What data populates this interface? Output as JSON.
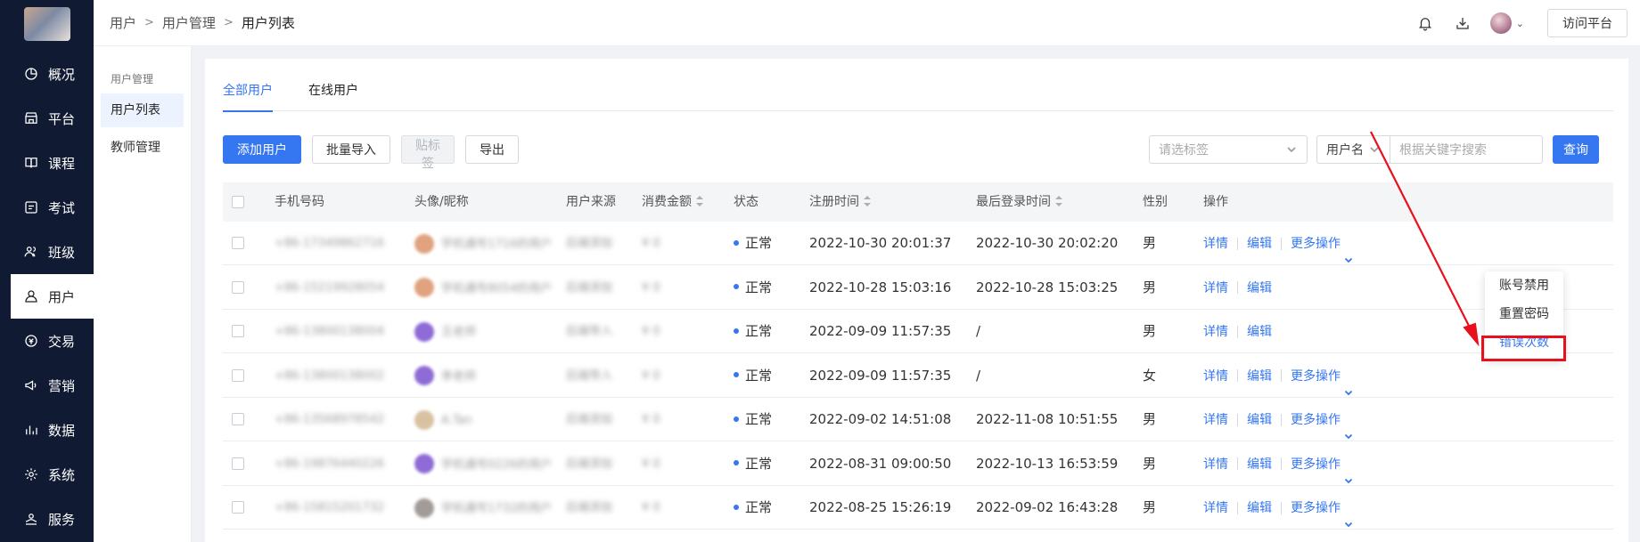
{
  "nav": {
    "items": [
      {
        "label": "概况",
        "icon": "overview-icon"
      },
      {
        "label": "平台",
        "icon": "store-icon"
      },
      {
        "label": "课程",
        "icon": "book-icon"
      },
      {
        "label": "考试",
        "icon": "exam-icon"
      },
      {
        "label": "班级",
        "icon": "class-icon"
      },
      {
        "label": "用户",
        "icon": "user-icon",
        "active": true
      },
      {
        "label": "交易",
        "icon": "trade-icon"
      },
      {
        "label": "营销",
        "icon": "marketing-icon"
      },
      {
        "label": "数据",
        "icon": "data-icon"
      },
      {
        "label": "系统",
        "icon": "system-icon"
      },
      {
        "label": "服务",
        "icon": "service-icon"
      }
    ]
  },
  "header": {
    "breadcrumb": [
      "用户",
      "用户管理",
      "用户列表"
    ],
    "visit_button": "访问平台"
  },
  "subnav": {
    "group": "用户管理",
    "items": [
      "用户列表",
      "教师管理"
    ]
  },
  "tabs": [
    "全部用户",
    "在线用户"
  ],
  "toolbar": {
    "add_user": "添加用户",
    "batch_import": "批量导入",
    "tag": "贴标签",
    "export": "导出",
    "tag_select_placeholder": "请选标签",
    "field_select": "用户名",
    "search_placeholder": "根据关键字搜索",
    "query": "查询"
  },
  "table": {
    "headers": {
      "phone": "手机号码",
      "avatar_name": "头像/昵称",
      "source": "用户来源",
      "amount": "消费金额",
      "status": "状态",
      "reg_time": "注册时间",
      "last_login": "最后登录时间",
      "gender": "性别",
      "action": "操作"
    },
    "rows": [
      {
        "phone": "+86-17349862716",
        "name": "学机通号1716的用户",
        "source": "后端添加",
        "amount": "¥ 0",
        "status": "正常",
        "reg_time": "2022-10-30 20:01:37",
        "last_login": "2022-10-30 20:02:20",
        "gender": "男",
        "avatar_color": "#e0a27f"
      },
      {
        "phone": "+86-15219928054",
        "name": "学机通号8054的用户",
        "source": "后端添加",
        "amount": "¥ 0",
        "status": "正常",
        "reg_time": "2022-10-28 15:03:16",
        "last_login": "2022-10-28 15:03:25",
        "gender": "男",
        "avatar_color": "#e0a27f"
      },
      {
        "phone": "+86-13800138004",
        "name": "王老师",
        "source": "后端导入",
        "amount": "¥ 0",
        "status": "正常",
        "reg_time": "2022-09-09 11:57:35",
        "last_login": "/",
        "gender": "男",
        "avatar_color": "#8e6bd6"
      },
      {
        "phone": "+86-13800138002",
        "name": "李老师",
        "source": "后端导入",
        "amount": "¥ 0",
        "status": "正常",
        "reg_time": "2022-09-09 11:57:35",
        "last_login": "/",
        "gender": "女",
        "avatar_color": "#8e6bd6"
      },
      {
        "phone": "+86-13568978542",
        "name": "A.Tan",
        "source": "后端添加",
        "amount": "¥ 0",
        "status": "正常",
        "reg_time": "2022-09-02 14:51:08",
        "last_login": "2022-11-08 10:51:55",
        "gender": "男",
        "avatar_color": "#d9c2a1"
      },
      {
        "phone": "+86-19876440226",
        "name": "学机通号0226的用户",
        "source": "后端添加",
        "amount": "¥ 0",
        "status": "正常",
        "reg_time": "2022-08-31 09:00:50",
        "last_login": "2022-10-13 16:53:59",
        "gender": "男",
        "avatar_color": "#8e6bd6"
      },
      {
        "phone": "+86-15815201732",
        "name": "学机通号1732的用户",
        "source": "后端添加",
        "amount": "¥ 0",
        "status": "正常",
        "reg_time": "2022-08-25 15:26:19",
        "last_login": "2022-09-02 16:43:28",
        "gender": "男",
        "avatar_color": "#a39b98"
      }
    ],
    "actions": {
      "detail": "详情",
      "edit": "编辑",
      "more": "更多操作"
    }
  },
  "dropdown": {
    "items": [
      "账号禁用",
      "重置密码",
      "错误次数"
    ],
    "highlight_index": 2
  },
  "colors": {
    "accent": "#3576f1",
    "nav_bg": "#111a33",
    "annotation": "#e8101c"
  }
}
